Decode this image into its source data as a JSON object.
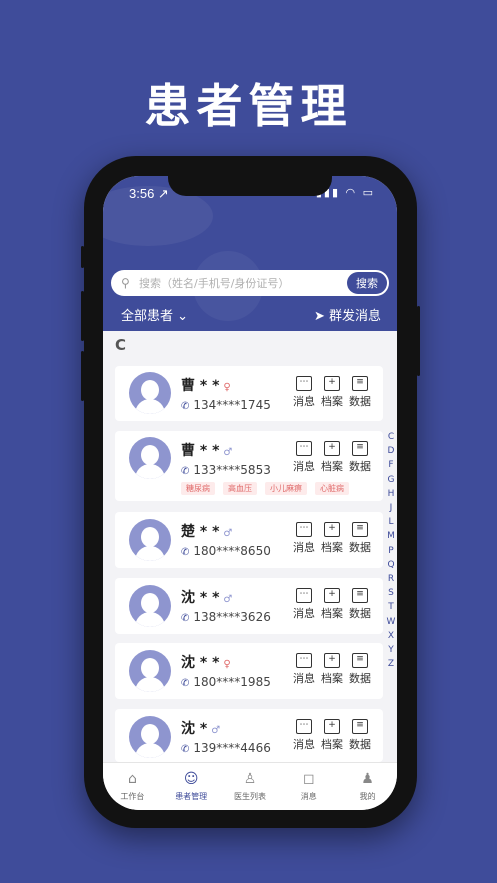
{
  "headline": "患者管理",
  "status": {
    "time": "3:56 ↗",
    "icons": "▮▮▮ ◠ ▭"
  },
  "search": {
    "placeholder": "搜索（姓名/手机号/身份证号）",
    "button": "搜索"
  },
  "filter": {
    "all": "全部患者 ⌄",
    "broadcast": "群发消息"
  },
  "section_letter": "C",
  "actions": {
    "message": "消息",
    "file": "档案",
    "data": "数据"
  },
  "patients": [
    {
      "name": "曹 * *",
      "gender": "♀",
      "phone": "134****1745",
      "tags": []
    },
    {
      "name": "曹 * *",
      "gender": "♂",
      "phone": "133****5853",
      "tags": [
        "糖尿病",
        "高血压",
        "小儿麻痹",
        "心脏病"
      ]
    },
    {
      "name": "楚 * *",
      "gender": "♂",
      "phone": "180****8650",
      "tags": []
    },
    {
      "name": "沈 * *",
      "gender": "♂",
      "phone": "138****3626",
      "tags": []
    },
    {
      "name": "沈 * *",
      "gender": "♀",
      "phone": "180****1985",
      "tags": []
    },
    {
      "name": "沈 *",
      "gender": "♂",
      "phone": "139****4466",
      "tags": []
    }
  ],
  "alphabet": [
    "C",
    "D",
    "F",
    "G",
    "H",
    "J",
    "L",
    "M",
    "P",
    "Q",
    "R",
    "S",
    "T",
    "W",
    "X",
    "Y",
    "Z"
  ],
  "tabs": [
    {
      "label": "工作台",
      "icon": "⌂"
    },
    {
      "label": "患者管理",
      "icon": "☺"
    },
    {
      "label": "医生列表",
      "icon": "♙"
    },
    {
      "label": "消息",
      "icon": "◻"
    },
    {
      "label": "我的",
      "icon": "♟"
    }
  ],
  "colors": {
    "brand": "#3F4C9A",
    "female": "#E06A6A",
    "male": "#8E95CF"
  }
}
